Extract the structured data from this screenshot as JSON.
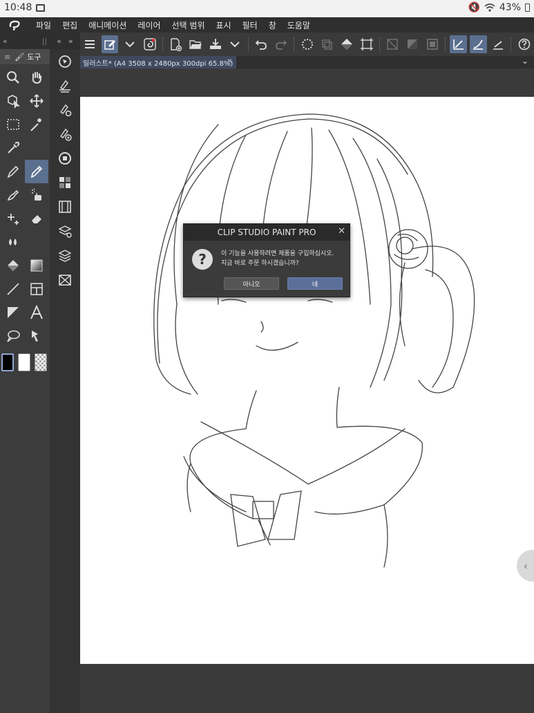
{
  "status": {
    "time": "10:48",
    "battery": "43%"
  },
  "menu": {
    "items": [
      "파일",
      "편집",
      "애니메이션",
      "레이어",
      "선택 범위",
      "표시",
      "필터",
      "창",
      "도움말"
    ]
  },
  "tool_panel": {
    "collapse_left": "«",
    "collapse_right": "»",
    "tab_label": "도구",
    "sub_collapse": "«"
  },
  "tab": {
    "document_title": "일러스트* (A4 3508 x 2480px 300dpi 65.8%)",
    "close": "×",
    "chevron": "⌄"
  },
  "dialog": {
    "title": "CLIP STUDIO PAINT PRO",
    "close": "✕",
    "message_line1": "이 기능을 사용하려면 제품을 구입하십시오.",
    "message_line2": "지금 바로 주문 하시겠습니까?",
    "no_label": "아니오",
    "yes_label": "네"
  },
  "colors": {
    "main": "#000000",
    "sub": "#ffffff",
    "accent": "#5b6f8f"
  },
  "side_handle": "‹"
}
